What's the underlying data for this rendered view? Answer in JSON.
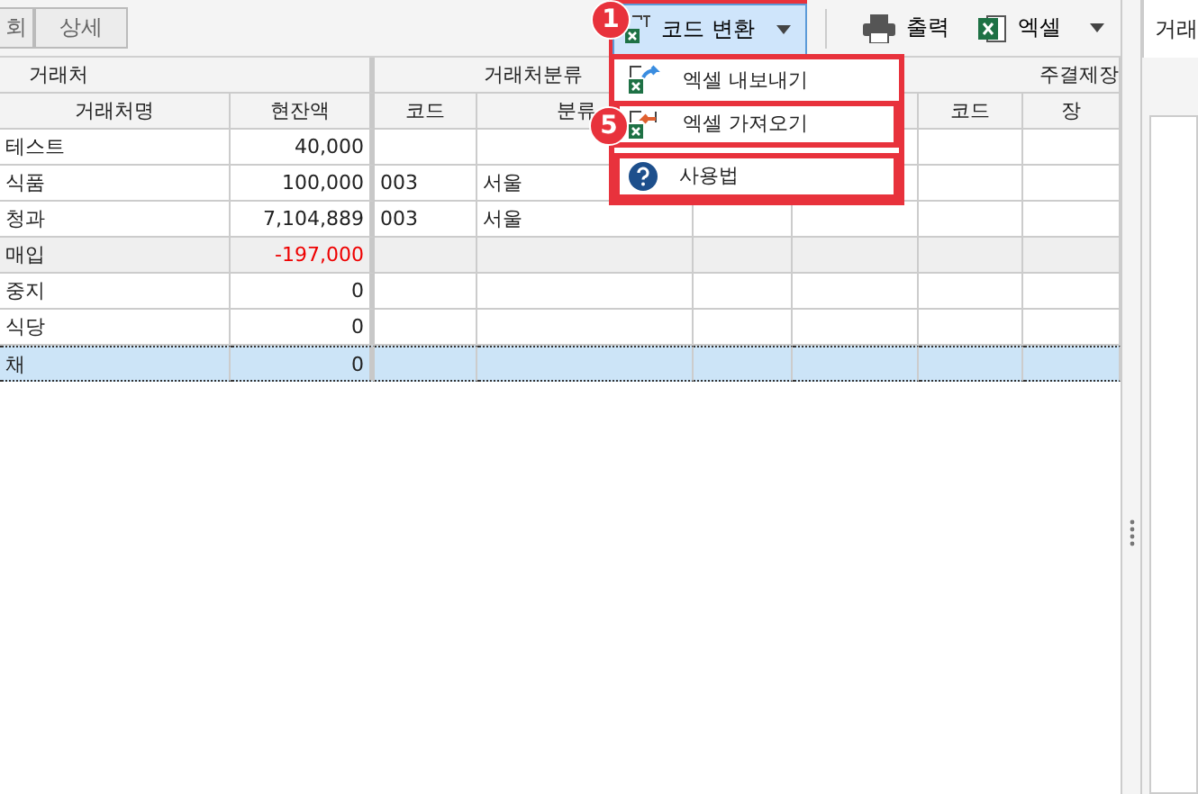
{
  "toolbar": {
    "left_buttons": [
      "회",
      "상세"
    ],
    "code_convert": {
      "label": "코드 변환",
      "highlighted": true
    },
    "print": {
      "label": "출력"
    },
    "excel": {
      "label": "엑셀"
    }
  },
  "side_tab": {
    "label": "거래"
  },
  "dropdown": {
    "items": [
      {
        "label": "엑셀 내보내기",
        "kind": "export"
      },
      {
        "label": "엑셀 가져오기",
        "kind": "import"
      },
      {
        "label": "사용법",
        "kind": "help"
      }
    ]
  },
  "callouts": [
    {
      "number": "1"
    },
    {
      "number": "5"
    }
  ],
  "table": {
    "groups": [
      "거래처",
      "거래처분류",
      "주결제장"
    ],
    "columns": [
      "거래처명",
      "현잔액",
      "코드",
      "분류",
      "",
      "",
      "코드",
      "장"
    ],
    "rows": [
      {
        "name": "테스트",
        "balance": "40,000",
        "code": "",
        "category": "",
        "negative": false,
        "shaded": false,
        "selected": false
      },
      {
        "name": "식품",
        "balance": "100,000",
        "code": "003",
        "category": "서울",
        "negative": false,
        "shaded": false,
        "selected": false
      },
      {
        "name": "청과",
        "balance": "7,104,889",
        "code": "003",
        "category": "서울",
        "negative": false,
        "shaded": false,
        "selected": false
      },
      {
        "name": "매입",
        "balance": "-197,000",
        "code": "",
        "category": "",
        "negative": true,
        "shaded": true,
        "selected": false
      },
      {
        "name": "중지",
        "balance": "0",
        "code": "",
        "category": "",
        "negative": false,
        "shaded": false,
        "selected": false
      },
      {
        "name": "식당",
        "balance": "0",
        "code": "",
        "category": "",
        "negative": false,
        "shaded": false,
        "selected": false
      },
      {
        "name": "채",
        "balance": "0",
        "code": "",
        "category": "",
        "negative": false,
        "shaded": false,
        "selected": true
      }
    ]
  }
}
